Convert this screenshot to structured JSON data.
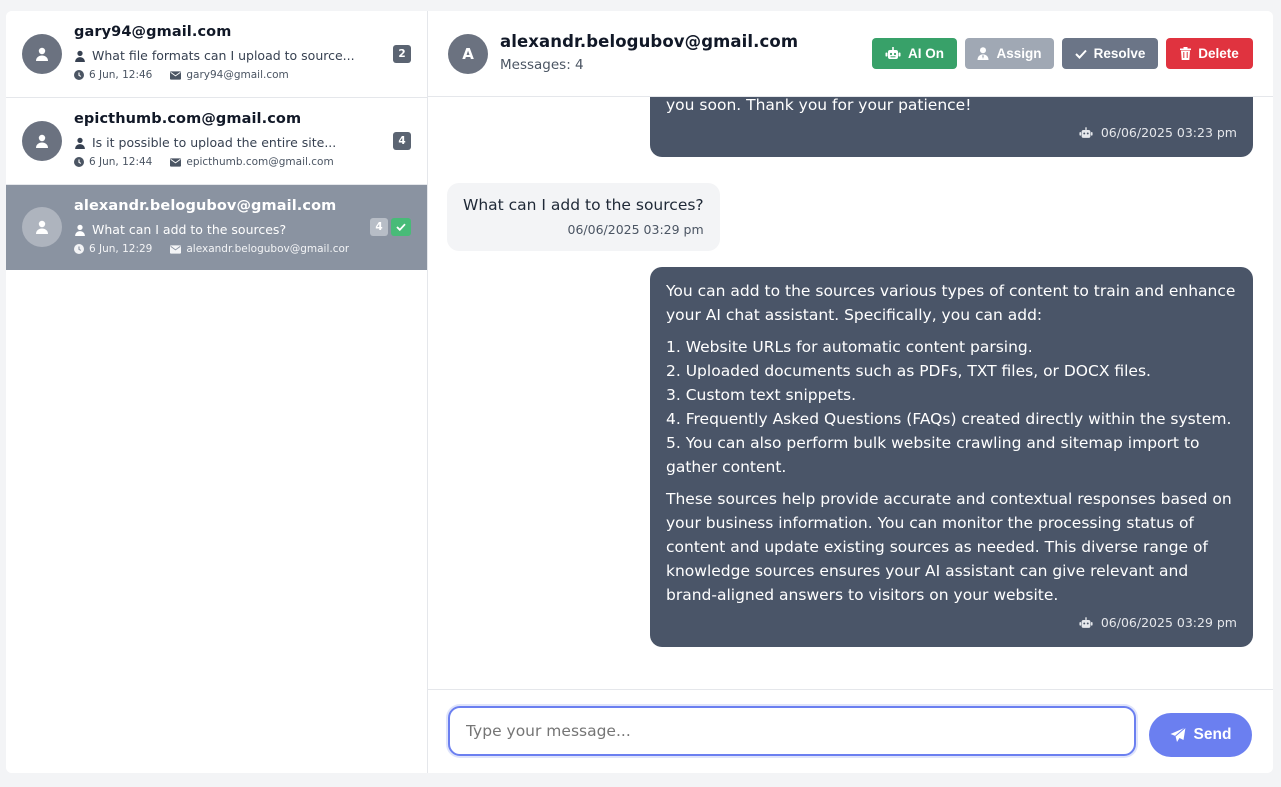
{
  "conversations": [
    {
      "email": "gary94@gmail.com",
      "preview": "What file formats can I upload to source...",
      "time": "6 Jun, 12:46",
      "contact": "gary94@gmail.com",
      "count": "2",
      "resolved": false,
      "active": false
    },
    {
      "email": "epicthumb.com@gmail.com",
      "preview": "Is it possible to upload the entire site...",
      "time": "6 Jun, 12:44",
      "contact": "epicthumb.com@gmail.com",
      "count": "4",
      "resolved": false,
      "active": false
    },
    {
      "email": "alexandr.belogubov@gmail.com",
      "preview": "What can I add to the sources?",
      "time": "6 Jun, 12:29",
      "contact": "alexandr.belogubov@gmail.cor",
      "count": "4",
      "resolved": true,
      "active": true
    }
  ],
  "header": {
    "avatar_letter": "A",
    "title": "alexandr.belogubov@gmail.com",
    "subtitle": "Messages: 4",
    "buttons": {
      "ai": "AI On",
      "assign": "Assign",
      "resolve": "Resolve",
      "delete": "Delete"
    }
  },
  "messages": {
    "m1": {
      "text": "you soon. Thank you for your patience!",
      "time": "06/06/2025 03:23 pm"
    },
    "m2": {
      "text": "What can I add to the sources?",
      "time": "06/06/2025 03:29 pm"
    },
    "m3": {
      "intro": "You can add to the sources various types of content to train and enhance your AI chat assistant. Specifically, you can add:",
      "items": [
        "1. Website URLs for automatic content parsing.",
        "2. Uploaded documents such as PDFs, TXT files, or DOCX files.",
        "3. Custom text snippets.",
        "4. Frequently Asked Questions (FAQs) created directly within the system.",
        "5. You can also perform bulk website crawling and sitemap import to gather content."
      ],
      "outro": "These sources help provide accurate and contextual responses based on your business information. You can monitor the processing status of content and update existing sources as needed. This diverse range of knowledge sources ensures your AI assistant can give relevant and brand-aligned answers to visitors on your website.",
      "time": "06/06/2025 03:29 pm"
    }
  },
  "composer": {
    "placeholder": "Type your message...",
    "send_label": "Send"
  },
  "colors": {
    "accent": "#6b7ff0",
    "ai_on": "#38a169",
    "delete": "#e0333f",
    "bot_bubble": "#4a5568"
  }
}
